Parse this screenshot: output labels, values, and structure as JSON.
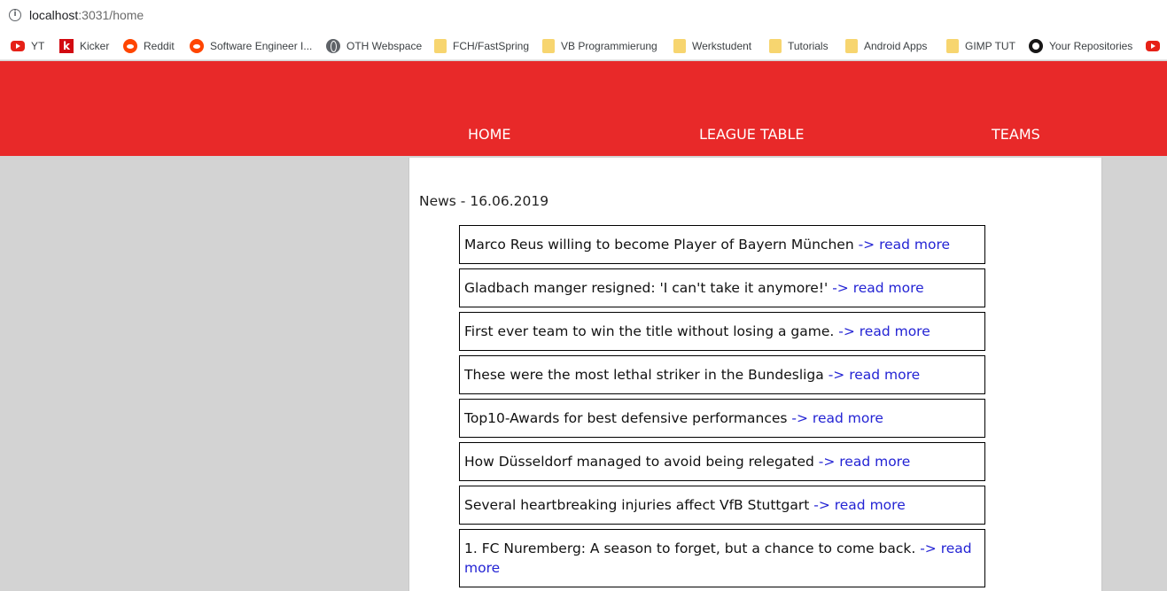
{
  "browser": {
    "url_host": "localhost",
    "url_path": ":3031/home",
    "bookmarks": [
      {
        "label": "YT",
        "icon": "youtube-icon"
      },
      {
        "label": "Kicker",
        "icon": "kicker-icon",
        "glyph": "k"
      },
      {
        "label": "Reddit",
        "icon": "reddit-icon"
      },
      {
        "label": "Software Engineer I...",
        "icon": "reddit-icon"
      },
      {
        "label": "OTH Webspace",
        "icon": "globe-icon"
      },
      {
        "label": "FCH/FastSpring",
        "icon": "folder-icon"
      },
      {
        "label": "VB Programmierung",
        "icon": "folder-icon"
      },
      {
        "label": "Werkstudent",
        "icon": "folder-icon"
      },
      {
        "label": "Tutorials",
        "icon": "folder-icon"
      },
      {
        "label": "Android Apps",
        "icon": "folder-icon"
      },
      {
        "label": "GIMP TUT",
        "icon": "folder-icon"
      },
      {
        "label": "Your Repositories",
        "icon": "github-icon"
      }
    ]
  },
  "nav": {
    "home": "HOME",
    "league_table": "LEAGUE TABLE",
    "teams": "TEAMS"
  },
  "news": {
    "title": "News - 16.06.2019",
    "read_more": "-> read more",
    "items": [
      {
        "headline": "Marco Reus willing to become Player of Bayern München"
      },
      {
        "headline": "Gladbach manger resigned: 'I can't take it anymore!'"
      },
      {
        "headline": "First ever team to win the title without losing a game."
      },
      {
        "headline": "These were the most lethal striker in the Bundesliga"
      },
      {
        "headline": "Top10-Awards for best defensive performances"
      },
      {
        "headline": "How Düsseldorf managed to avoid being relegated"
      },
      {
        "headline": "Several heartbreaking injuries affect VfB Stuttgart"
      },
      {
        "headline": "1. FC Nuremberg: A season to forget, but a chance to come back."
      }
    ]
  },
  "colors": {
    "header_red": "#e82929",
    "link_blue": "#2323d4",
    "page_gray": "#d3d3d3"
  }
}
